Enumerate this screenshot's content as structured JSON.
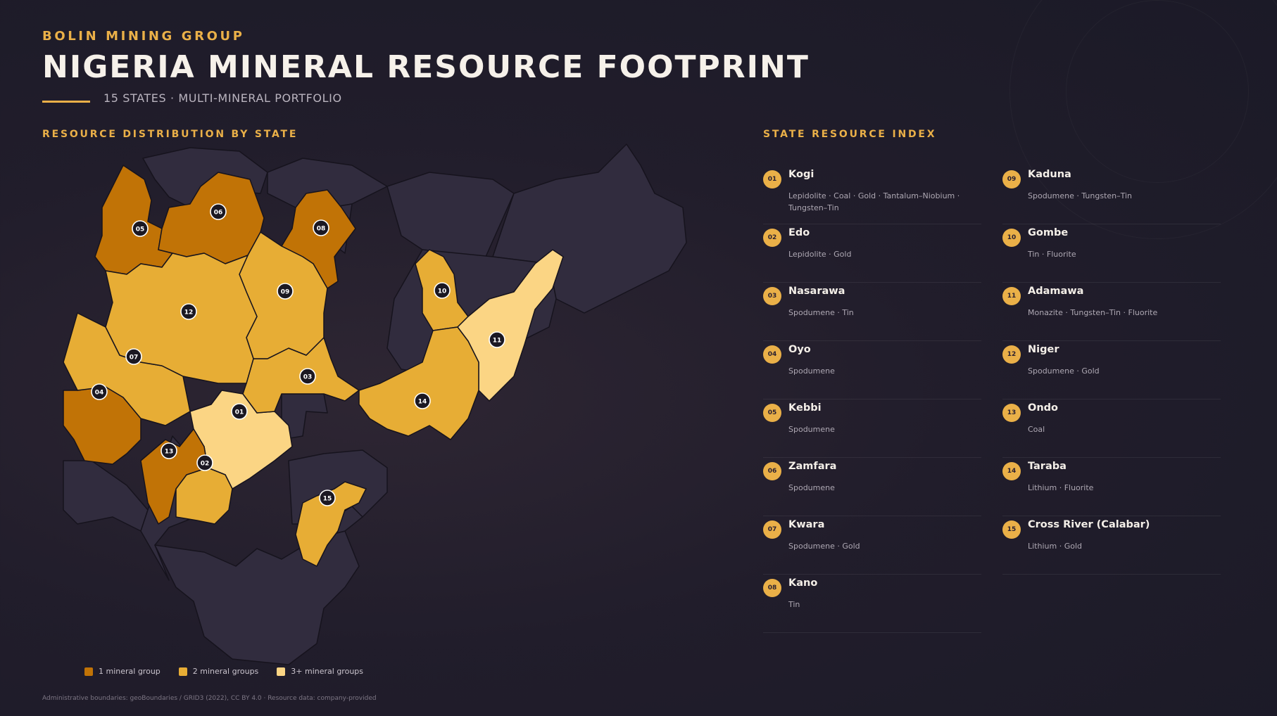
{
  "header": {
    "eyebrow": "BOLIN MINING GROUP",
    "title": "NIGERIA MINERAL RESOURCE FOOTPRINT",
    "subtitle": "15 STATES · MULTI-MINERAL PORTFOLIO"
  },
  "map_section": {
    "label": "RESOURCE DISTRIBUTION BY STATE"
  },
  "index_section": {
    "label": "STATE RESOURCE INDEX"
  },
  "colors": {
    "accent": "#eab048",
    "tier1": "#c17306",
    "tier2": "#e7ad35",
    "tier3": "#fbd584",
    "other_state": "#312c3e",
    "border": "#16131d"
  },
  "states": [
    {
      "num": "01",
      "name": "Kogi",
      "minerals": "Lepidolite · Coal · Gold · Tantalum–Niobium · Tungsten–Tin",
      "tier": 3
    },
    {
      "num": "02",
      "name": "Edo",
      "minerals": "Lepidolite · Gold",
      "tier": 2
    },
    {
      "num": "03",
      "name": "Nasarawa",
      "minerals": "Spodumene · Tin",
      "tier": 2
    },
    {
      "num": "04",
      "name": "Oyo",
      "minerals": "Spodumene",
      "tier": 1
    },
    {
      "num": "05",
      "name": "Kebbi",
      "minerals": "Spodumene",
      "tier": 1
    },
    {
      "num": "06",
      "name": "Zamfara",
      "minerals": "Spodumene",
      "tier": 1
    },
    {
      "num": "07",
      "name": "Kwara",
      "minerals": "Spodumene · Gold",
      "tier": 2
    },
    {
      "num": "08",
      "name": "Kano",
      "minerals": "Tin",
      "tier": 1
    },
    {
      "num": "09",
      "name": "Kaduna",
      "minerals": "Spodumene · Tungsten–Tin",
      "tier": 2
    },
    {
      "num": "10",
      "name": "Gombe",
      "minerals": "Tin · Fluorite",
      "tier": 2
    },
    {
      "num": "11",
      "name": "Adamawa",
      "minerals": "Monazite · Tungsten–Tin · Fluorite",
      "tier": 3
    },
    {
      "num": "12",
      "name": "Niger",
      "minerals": "Spodumene · Gold",
      "tier": 2
    },
    {
      "num": "13",
      "name": "Ondo",
      "minerals": "Coal",
      "tier": 1
    },
    {
      "num": "14",
      "name": "Taraba",
      "minerals": "Lithium · Fluorite",
      "tier": 2
    },
    {
      "num": "15",
      "name": "Cross River (Calabar)",
      "minerals": "Lithium · Gold",
      "tier": 2
    }
  ],
  "legend": [
    {
      "label": "1 mineral group",
      "color": "#c17306"
    },
    {
      "label": "2 mineral groups",
      "color": "#e7ad35"
    },
    {
      "label": "3+ mineral groups",
      "color": "#fbd584"
    }
  ],
  "source": "Administrative boundaries: geoBoundaries / GRID3 (2022), CC BY 4.0 · Resource data: company-provided"
}
